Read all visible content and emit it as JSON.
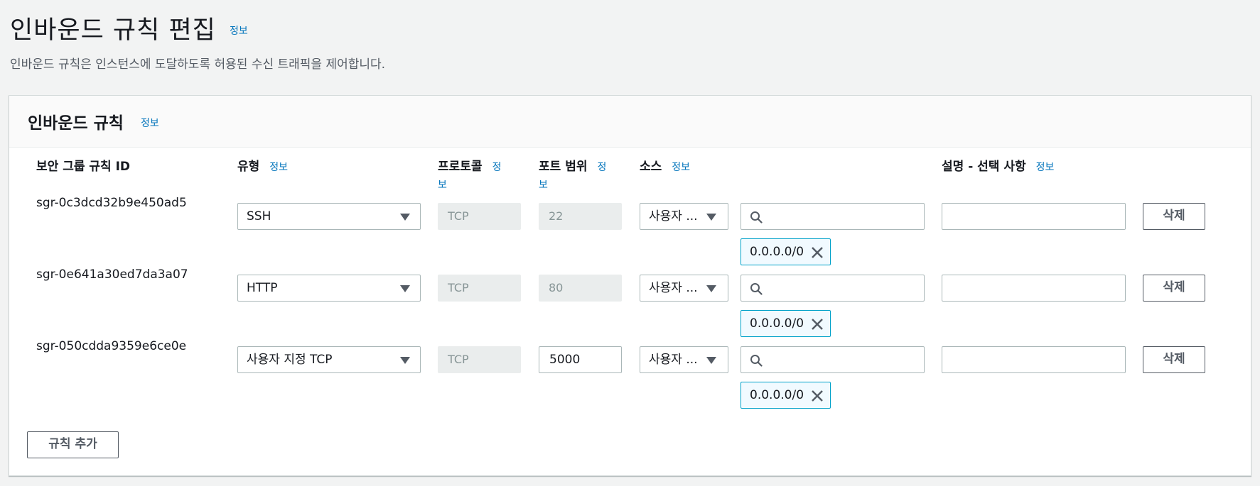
{
  "page": {
    "title": "인바운드 규칙 편집",
    "title_info": "정보",
    "description": "인바운드 규칙은 인스턴스에 도달하도록 허용된 수신 트래픽을 제어합니다."
  },
  "panel": {
    "title": "인바운드 규칙",
    "title_info": "정보"
  },
  "columns": {
    "rule_id": "보안 그룹 규칙 ID",
    "type": "유형",
    "type_info": "정보",
    "protocol": "프로토콜",
    "protocol_info_1": "정",
    "protocol_info_2": "보",
    "port_range": "포트 범위",
    "port_info_1": "정",
    "port_info_2": "보",
    "source": "소스",
    "source_info": "정보",
    "description": "설명 - 선택 사항",
    "description_info": "정보"
  },
  "rules": [
    {
      "id": "sgr-0c3dcd32b9e450ad5",
      "type": "SSH",
      "protocol": "TCP",
      "port": "22",
      "source_type": "사용자 ...",
      "search_value": "",
      "cidr": "0.0.0.0/0",
      "description": "",
      "delete_label": "삭제"
    },
    {
      "id": "sgr-0e641a30ed7da3a07",
      "type": "HTTP",
      "protocol": "TCP",
      "port": "80",
      "source_type": "사용자 ...",
      "search_value": "",
      "cidr": "0.0.0.0/0",
      "description": "",
      "delete_label": "삭제"
    },
    {
      "id": "sgr-050cdda9359e6ce0e",
      "type": "사용자 지정 TCP",
      "protocol": "TCP",
      "port": "5000",
      "source_type": "사용자 ...",
      "search_value": "",
      "cidr": "0.0.0.0/0",
      "description": "",
      "delete_label": "삭제"
    }
  ],
  "add_rule_label": "규칙 추가",
  "icons": {
    "select_caret": "caret-down-icon",
    "search": "search-icon",
    "remove_token": "close-icon"
  },
  "colors": {
    "link": "#0073bb",
    "token_bg": "#f1faff",
    "token_border": "#00a1c9"
  }
}
